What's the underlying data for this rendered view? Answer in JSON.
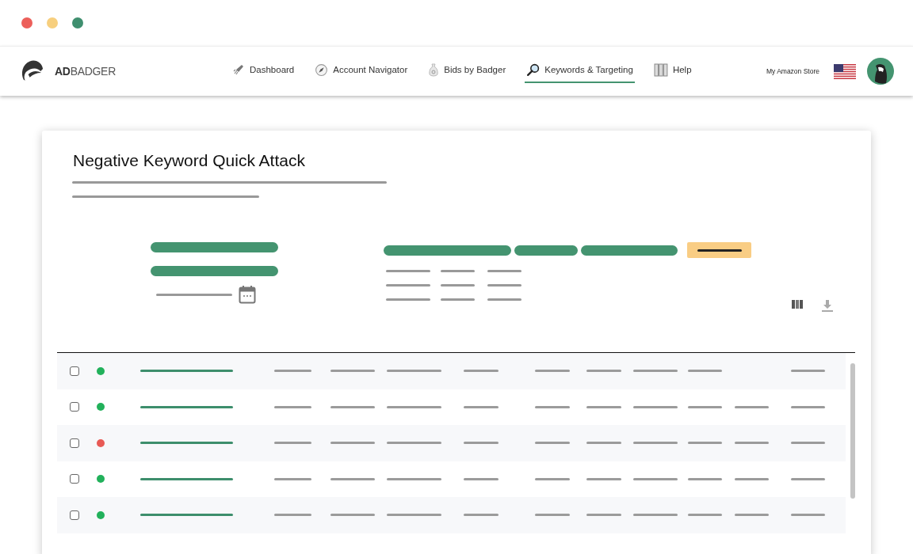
{
  "window": {
    "controls": [
      {
        "color": "#ec5f5a"
      },
      {
        "color": "#f7cf7e"
      },
      {
        "color": "#3f8f6f"
      }
    ]
  },
  "brand": {
    "bold": "AD",
    "light": "BADGER"
  },
  "nav": [
    {
      "label": "Dashboard",
      "kind": "rocket",
      "selected": false
    },
    {
      "label": "Account Navigator",
      "kind": "compass",
      "selected": false
    },
    {
      "label": "Bids by Badger",
      "kind": "bag",
      "selected": false
    },
    {
      "label": "Keywords & Targeting",
      "kind": "magnifier",
      "selected": true
    },
    {
      "label": "Help",
      "kind": "binders",
      "selected": false
    }
  ],
  "store": {
    "label": "My Amazon Store"
  },
  "card": {
    "title": "Negative Keyword Quick Attack"
  },
  "rows": [
    {
      "checked": false,
      "color": "#22b15b",
      "filled": [
        true,
        true,
        true,
        true,
        true,
        true,
        true,
        true,
        true,
        false,
        true
      ]
    },
    {
      "checked": false,
      "color": "#22b15b",
      "filled": [
        true,
        true,
        true,
        true,
        true,
        true,
        true,
        true,
        true,
        true,
        true
      ]
    },
    {
      "checked": false,
      "color": "#e85a55",
      "filled": [
        true,
        true,
        true,
        true,
        true,
        true,
        true,
        true,
        true,
        true,
        true
      ]
    },
    {
      "checked": false,
      "color": "#22b15b",
      "filled": [
        true,
        true,
        true,
        true,
        true,
        true,
        true,
        true,
        true,
        true,
        true
      ]
    },
    {
      "checked": false,
      "color": "#22b15b",
      "filled": [
        true,
        true,
        true,
        true,
        true,
        true,
        true,
        true,
        true,
        true,
        true
      ]
    }
  ]
}
